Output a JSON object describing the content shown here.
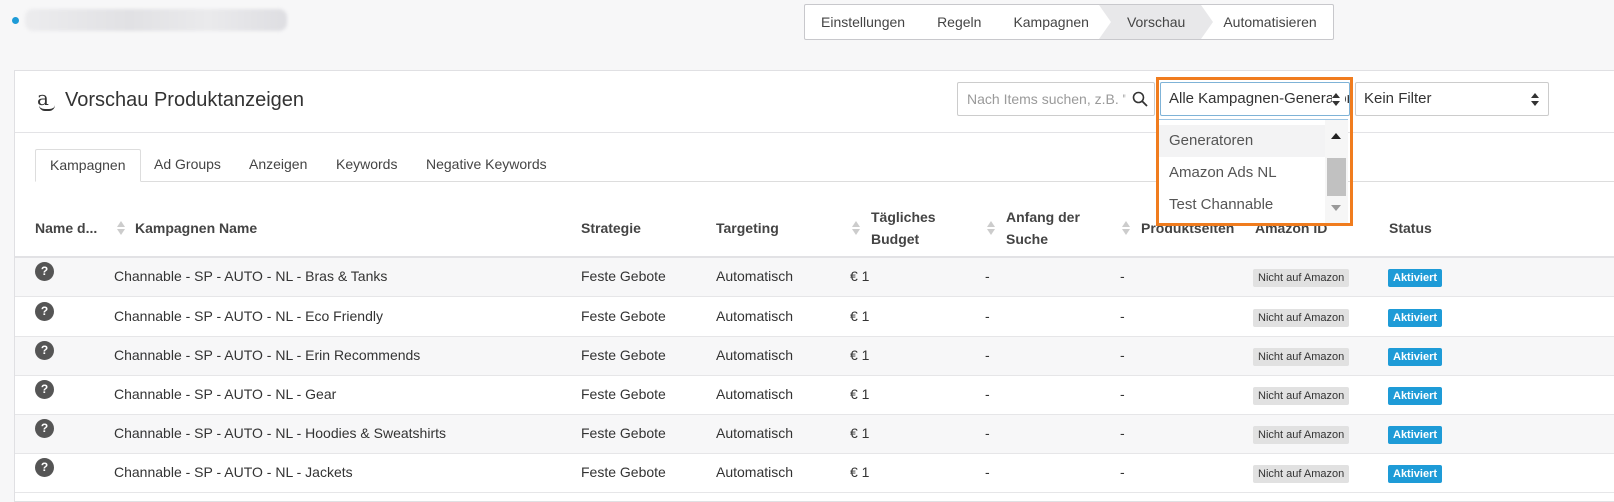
{
  "topbar": {
    "steps": [
      "Einstellungen",
      "Regeln",
      "Kampagnen",
      "Vorschau",
      "Automatisieren"
    ],
    "active_step": "Vorschau"
  },
  "panel": {
    "title": "Vorschau Produktanzeigen",
    "search_placeholder": "Nach Items suchen, z.B. \"",
    "generator_select": "Alle Kampagnen-Generatoren",
    "filter_select": "Kein Filter"
  },
  "dropdown": {
    "options": [
      "Generatoren",
      "Amazon Ads NL",
      "Test Channable"
    ]
  },
  "tabs": [
    "Kampagnen",
    "Ad Groups",
    "Anzeigen",
    "Keywords",
    "Negative Keywords"
  ],
  "columns": {
    "name": "Name d...",
    "campaign": "Kampagnen Name",
    "strategy": "Strategie",
    "targeting": "Targeting",
    "budget_1": "Tägliches",
    "budget_2": "Budget",
    "start_1": "Anfang der",
    "start_2": "Suche",
    "product": "Produktseiten",
    "amazon_id": "Amazon ID",
    "status": "Status"
  },
  "rows": [
    {
      "campaign": "Channable - SP - AUTO - NL - Bras & Tanks",
      "strategy": "Feste Gebote",
      "targeting": "Automatisch",
      "budget": "€ 1",
      "start": "-",
      "product": "-",
      "amazon_id": "Nicht auf Amazon",
      "status": "Aktiviert"
    },
    {
      "campaign": "Channable - SP - AUTO - NL - Eco Friendly",
      "strategy": "Feste Gebote",
      "targeting": "Automatisch",
      "budget": "€ 1",
      "start": "-",
      "product": "-",
      "amazon_id": "Nicht auf Amazon",
      "status": "Aktiviert"
    },
    {
      "campaign": "Channable - SP - AUTO - NL - Erin Recommends",
      "strategy": "Feste Gebote",
      "targeting": "Automatisch",
      "budget": "€ 1",
      "start": "-",
      "product": "-",
      "amazon_id": "Nicht auf Amazon",
      "status": "Aktiviert"
    },
    {
      "campaign": "Channable - SP - AUTO - NL - Gear",
      "strategy": "Feste Gebote",
      "targeting": "Automatisch",
      "budget": "€ 1",
      "start": "-",
      "product": "-",
      "amazon_id": "Nicht auf Amazon",
      "status": "Aktiviert"
    },
    {
      "campaign": "Channable - SP - AUTO - NL - Hoodies & Sweatshirts",
      "strategy": "Feste Gebote",
      "targeting": "Automatisch",
      "budget": "€ 1",
      "start": "-",
      "product": "-",
      "amazon_id": "Nicht auf Amazon",
      "status": "Aktiviert"
    },
    {
      "campaign": "Channable - SP - AUTO - NL - Jackets",
      "strategy": "Feste Gebote",
      "targeting": "Automatisch",
      "budget": "€ 1",
      "start": "-",
      "product": "-",
      "amazon_id": "Nicht auf Amazon",
      "status": "Aktiviert"
    }
  ],
  "colors": {
    "accent_blue": "#1e9bd7",
    "highlight_orange": "#f07c1e"
  }
}
